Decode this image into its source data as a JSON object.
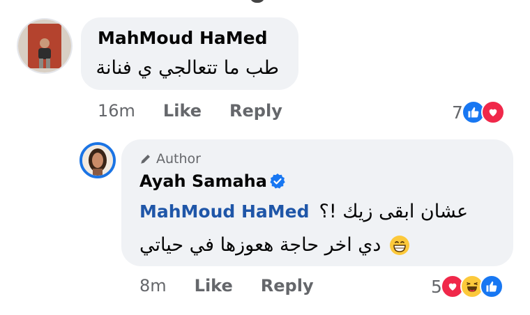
{
  "comment": {
    "author": "MahMoud HaMed",
    "text": "طب ما تتعالجي ي فنانة",
    "time": "16m",
    "like_label": "Like",
    "reply_label": "Reply",
    "reaction_count": "7",
    "reactions": [
      "like-icon",
      "love-icon"
    ]
  },
  "reply": {
    "badge": "Author",
    "author": "Ayah Samaha",
    "verified": true,
    "mention": "MahMoud HaMed",
    "line1": "عشان ابقى زيك !؟",
    "line2": "دي اخر حاجة هعوزها في حياتي",
    "emoji": "grinning-face-icon",
    "time": "8m",
    "like_label": "Like",
    "reply_label": "Reply",
    "reaction_count": "5",
    "reactions": [
      "love-icon",
      "haha-icon",
      "like-icon"
    ]
  },
  "colors": {
    "bubble": "#f0f2f5",
    "text": "#050505",
    "meta": "#65676b",
    "mention": "#1f56a8",
    "like_blue": "#1877f2",
    "love_red": "#f0284a",
    "haha_yellow": "#fcc93b"
  }
}
